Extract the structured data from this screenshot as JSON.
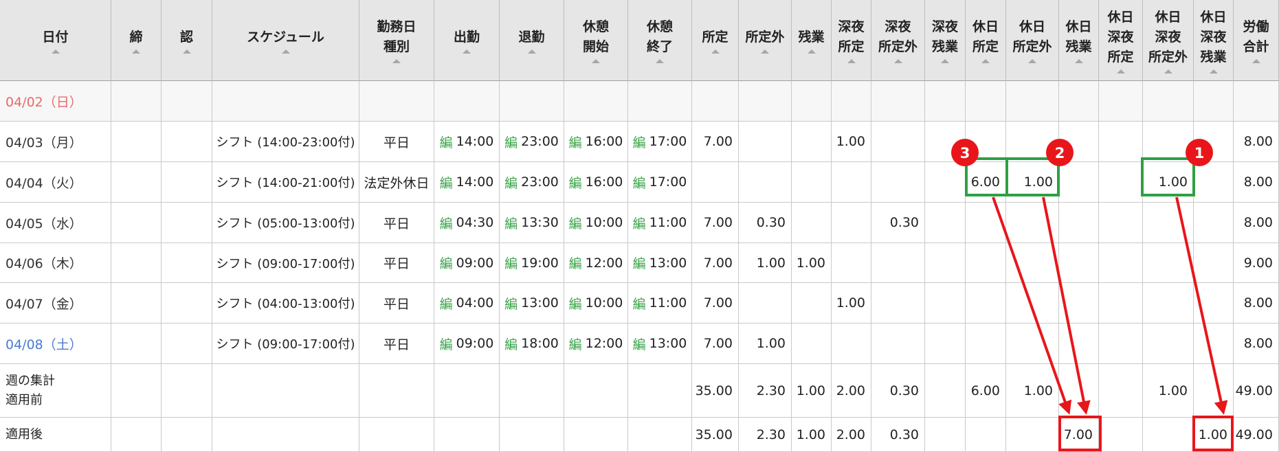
{
  "columns": [
    {
      "key": "date",
      "label": "日付"
    },
    {
      "key": "close",
      "label": "締"
    },
    {
      "key": "approve",
      "label": "認"
    },
    {
      "key": "schedule",
      "label": "スケジュール"
    },
    {
      "key": "daytype",
      "label": "勤務日\n種別"
    },
    {
      "key": "in",
      "label": "出勤"
    },
    {
      "key": "out",
      "label": "退勤"
    },
    {
      "key": "bstart",
      "label": "休憩\n開始"
    },
    {
      "key": "bend",
      "label": "休憩\n終了"
    },
    {
      "key": "reg",
      "label": "所定"
    },
    {
      "key": "nonreg",
      "label": "所定外"
    },
    {
      "key": "ot",
      "label": "残業"
    },
    {
      "key": "n_reg",
      "label": "深夜\n所定"
    },
    {
      "key": "n_nonreg",
      "label": "深夜\n所定外"
    },
    {
      "key": "n_ot",
      "label": "深夜\n残業"
    },
    {
      "key": "h_reg",
      "label": "休日\n所定"
    },
    {
      "key": "h_nonreg",
      "label": "休日\n所定外"
    },
    {
      "key": "h_ot",
      "label": "休日\n残業"
    },
    {
      "key": "hn_reg",
      "label": "休日\n深夜\n所定"
    },
    {
      "key": "hn_nonreg",
      "label": "休日\n深夜\n所定外"
    },
    {
      "key": "hn_ot",
      "label": "休日\n深夜\n残業"
    },
    {
      "key": "total",
      "label": "労働\n合計"
    }
  ],
  "edit_mark": "編",
  "rows": [
    {
      "date": "04/02（日）",
      "date_type": "sun",
      "schedule": "",
      "daytype": "",
      "in": "",
      "out": "",
      "bstart": "",
      "bend": "",
      "reg": "",
      "nonreg": "",
      "ot": "",
      "n_reg": "",
      "n_nonreg": "",
      "n_ot": "",
      "h_reg": "",
      "h_nonreg": "",
      "h_ot": "",
      "hn_reg": "",
      "hn_nonreg": "",
      "hn_ot": "",
      "total": ""
    },
    {
      "date": "04/03（月）",
      "date_type": "norm",
      "schedule": "シフト (14:00-23:00付)",
      "daytype": "平日",
      "in": "14:00",
      "out": "23:00",
      "bstart": "16:00",
      "bend": "17:00",
      "reg": "7.00",
      "nonreg": "",
      "ot": "",
      "n_reg": "1.00",
      "n_nonreg": "",
      "n_ot": "",
      "h_reg": "",
      "h_nonreg": "",
      "h_ot": "",
      "hn_reg": "",
      "hn_nonreg": "",
      "hn_ot": "",
      "total": "8.00"
    },
    {
      "date": "04/04（火）",
      "date_type": "norm",
      "schedule": "シフト (14:00-21:00付)",
      "daytype": "法定外休日",
      "in": "14:00",
      "out": "23:00",
      "bstart": "16:00",
      "bend": "17:00",
      "reg": "",
      "nonreg": "",
      "ot": "",
      "n_reg": "",
      "n_nonreg": "",
      "n_ot": "",
      "h_reg": "6.00",
      "h_nonreg": "1.00",
      "h_ot": "",
      "hn_reg": "",
      "hn_nonreg": "1.00",
      "hn_ot": "",
      "total": "8.00"
    },
    {
      "date": "04/05（水）",
      "date_type": "norm",
      "schedule": "シフト (05:00-13:00付)",
      "daytype": "平日",
      "in": "04:30",
      "out": "13:30",
      "bstart": "10:00",
      "bend": "11:00",
      "reg": "7.00",
      "nonreg": "0.30",
      "ot": "",
      "n_reg": "",
      "n_nonreg": "0.30",
      "n_ot": "",
      "h_reg": "",
      "h_nonreg": "",
      "h_ot": "",
      "hn_reg": "",
      "hn_nonreg": "",
      "hn_ot": "",
      "total": "8.00"
    },
    {
      "date": "04/06（木）",
      "date_type": "norm",
      "schedule": "シフト (09:00-17:00付)",
      "daytype": "平日",
      "in": "09:00",
      "out": "19:00",
      "bstart": "12:00",
      "bend": "13:00",
      "reg": "7.00",
      "nonreg": "1.00",
      "ot": "1.00",
      "n_reg": "",
      "n_nonreg": "",
      "n_ot": "",
      "h_reg": "",
      "h_nonreg": "",
      "h_ot": "",
      "hn_reg": "",
      "hn_nonreg": "",
      "hn_ot": "",
      "total": "9.00"
    },
    {
      "date": "04/07（金）",
      "date_type": "norm",
      "schedule": "シフト (04:00-13:00付)",
      "daytype": "平日",
      "in": "04:00",
      "out": "13:00",
      "bstart": "10:00",
      "bend": "11:00",
      "reg": "7.00",
      "nonreg": "",
      "ot": "",
      "n_reg": "1.00",
      "n_nonreg": "",
      "n_ot": "",
      "h_reg": "",
      "h_nonreg": "",
      "h_ot": "",
      "hn_reg": "",
      "hn_nonreg": "",
      "hn_ot": "",
      "total": "8.00"
    },
    {
      "date": "04/08（土）",
      "date_type": "sat",
      "schedule": "シフト (09:00-17:00付)",
      "daytype": "平日",
      "in": "09:00",
      "out": "18:00",
      "bstart": "12:00",
      "bend": "13:00",
      "reg": "7.00",
      "nonreg": "1.00",
      "ot": "",
      "n_reg": "",
      "n_nonreg": "",
      "n_ot": "",
      "h_reg": "",
      "h_nonreg": "",
      "h_ot": "",
      "hn_reg": "",
      "hn_nonreg": "",
      "hn_ot": "",
      "total": "8.00"
    }
  ],
  "summary_rows": [
    {
      "label_lines": [
        "週の集計",
        "適用前"
      ],
      "reg": "35.00",
      "nonreg": "2.30",
      "ot": "1.00",
      "n_reg": "2.00",
      "n_nonreg": "0.30",
      "n_ot": "",
      "h_reg": "6.00",
      "h_nonreg": "1.00",
      "h_ot": "",
      "hn_reg": "",
      "hn_nonreg": "1.00",
      "hn_ot": "",
      "total": "49.00"
    },
    {
      "label_lines": [
        "適用後"
      ],
      "reg": "35.00",
      "nonreg": "2.30",
      "ot": "1.00",
      "n_reg": "2.00",
      "n_nonreg": "0.30",
      "n_ot": "",
      "h_reg": "",
      "h_nonreg": "",
      "h_ot": "7.00",
      "hn_reg": "",
      "hn_nonreg": "",
      "hn_ot": "1.00",
      "total": "49.00"
    }
  ],
  "callouts": [
    {
      "number": "1",
      "color": "#e8161b"
    },
    {
      "number": "2",
      "color": "#e8161b"
    },
    {
      "number": "3",
      "color": "#e8161b"
    }
  ],
  "colors": {
    "highlight_green": "#2ea043",
    "highlight_red": "#e8161b",
    "header_bg": "#e6e6e6",
    "edit_mark": "#3aa34a",
    "sunday": "#e86a6a",
    "saturday": "#4a7bd0"
  }
}
